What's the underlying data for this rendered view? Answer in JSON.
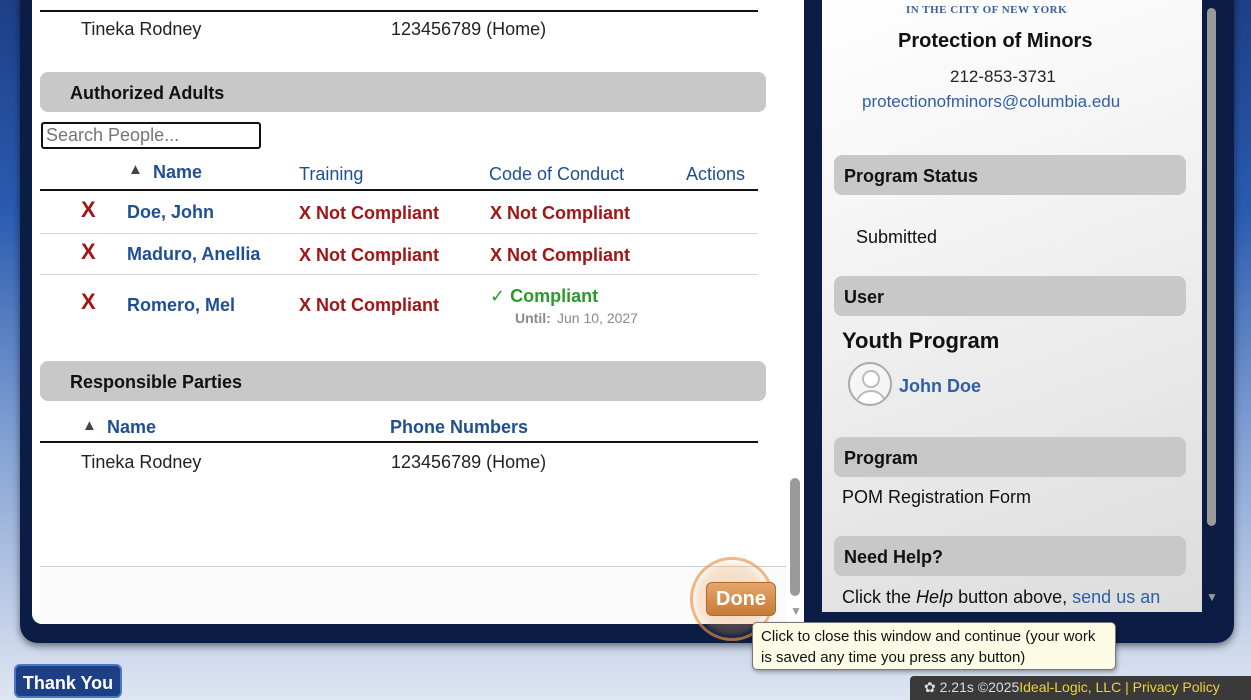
{
  "top_row": {
    "name": "Tineka Rodney",
    "phone": "123456789 (Home)"
  },
  "authorized_adults": {
    "title": "Authorized Adults",
    "search_placeholder": "Search People...",
    "headers": {
      "sort_arrow": "▲",
      "name": "Name",
      "training": "Training",
      "conduct": "Code of Conduct",
      "actions": "Actions"
    },
    "rows": [
      {
        "remove": "X",
        "name": "Doe, John",
        "training": "X Not Compliant",
        "conduct": "X Not Compliant"
      },
      {
        "remove": "X",
        "name": "Maduro, Anellia",
        "training": "X Not Compliant",
        "conduct": "X Not Compliant"
      },
      {
        "remove": "X",
        "name": "Romero, Mel",
        "training": "X Not Compliant",
        "conduct": "✓ Compliant",
        "until_label": "Until:",
        "until_date": "Jun 10, 2027"
      }
    ]
  },
  "responsible_parties": {
    "title": "Responsible Parties",
    "headers": {
      "sort_arrow": "▲",
      "name": "Name",
      "phones": "Phone Numbers"
    },
    "rows": [
      {
        "name": "Tineka Rodney",
        "phone": "123456789 (Home)"
      }
    ]
  },
  "done_button": "Done",
  "sidebar": {
    "org_caption": "IN THE CITY OF NEW YORK",
    "office": "Protection of Minors",
    "phone": "212-853-3731",
    "email": "protectionofminors@columbia.edu",
    "program_status_title": "Program Status",
    "program_status": "Submitted",
    "user_title": "User",
    "user_program": "Youth Program",
    "user_name": "John Doe",
    "program_title": "Program",
    "program_name": "POM Registration Form",
    "help_title": "Need Help?",
    "help_prefix": "Click the ",
    "help_em": "Help",
    "help_middle": " button above, ",
    "help_link": "send us an"
  },
  "thank_you_button": "Thank You",
  "tooltip": "Click to close this window and continue (your work is saved any time you press any button)",
  "footer": {
    "timing": "2.21s",
    "copyright": "©2025",
    "company": "Ideal-Logic, LLC",
    "separator": "|",
    "privacy": "Privacy Policy"
  },
  "colors": {
    "link": "#1f4f93",
    "error": "#a11515",
    "success": "#2a9b2a",
    "done": "#c77a37",
    "navy": "#1d3f86"
  }
}
